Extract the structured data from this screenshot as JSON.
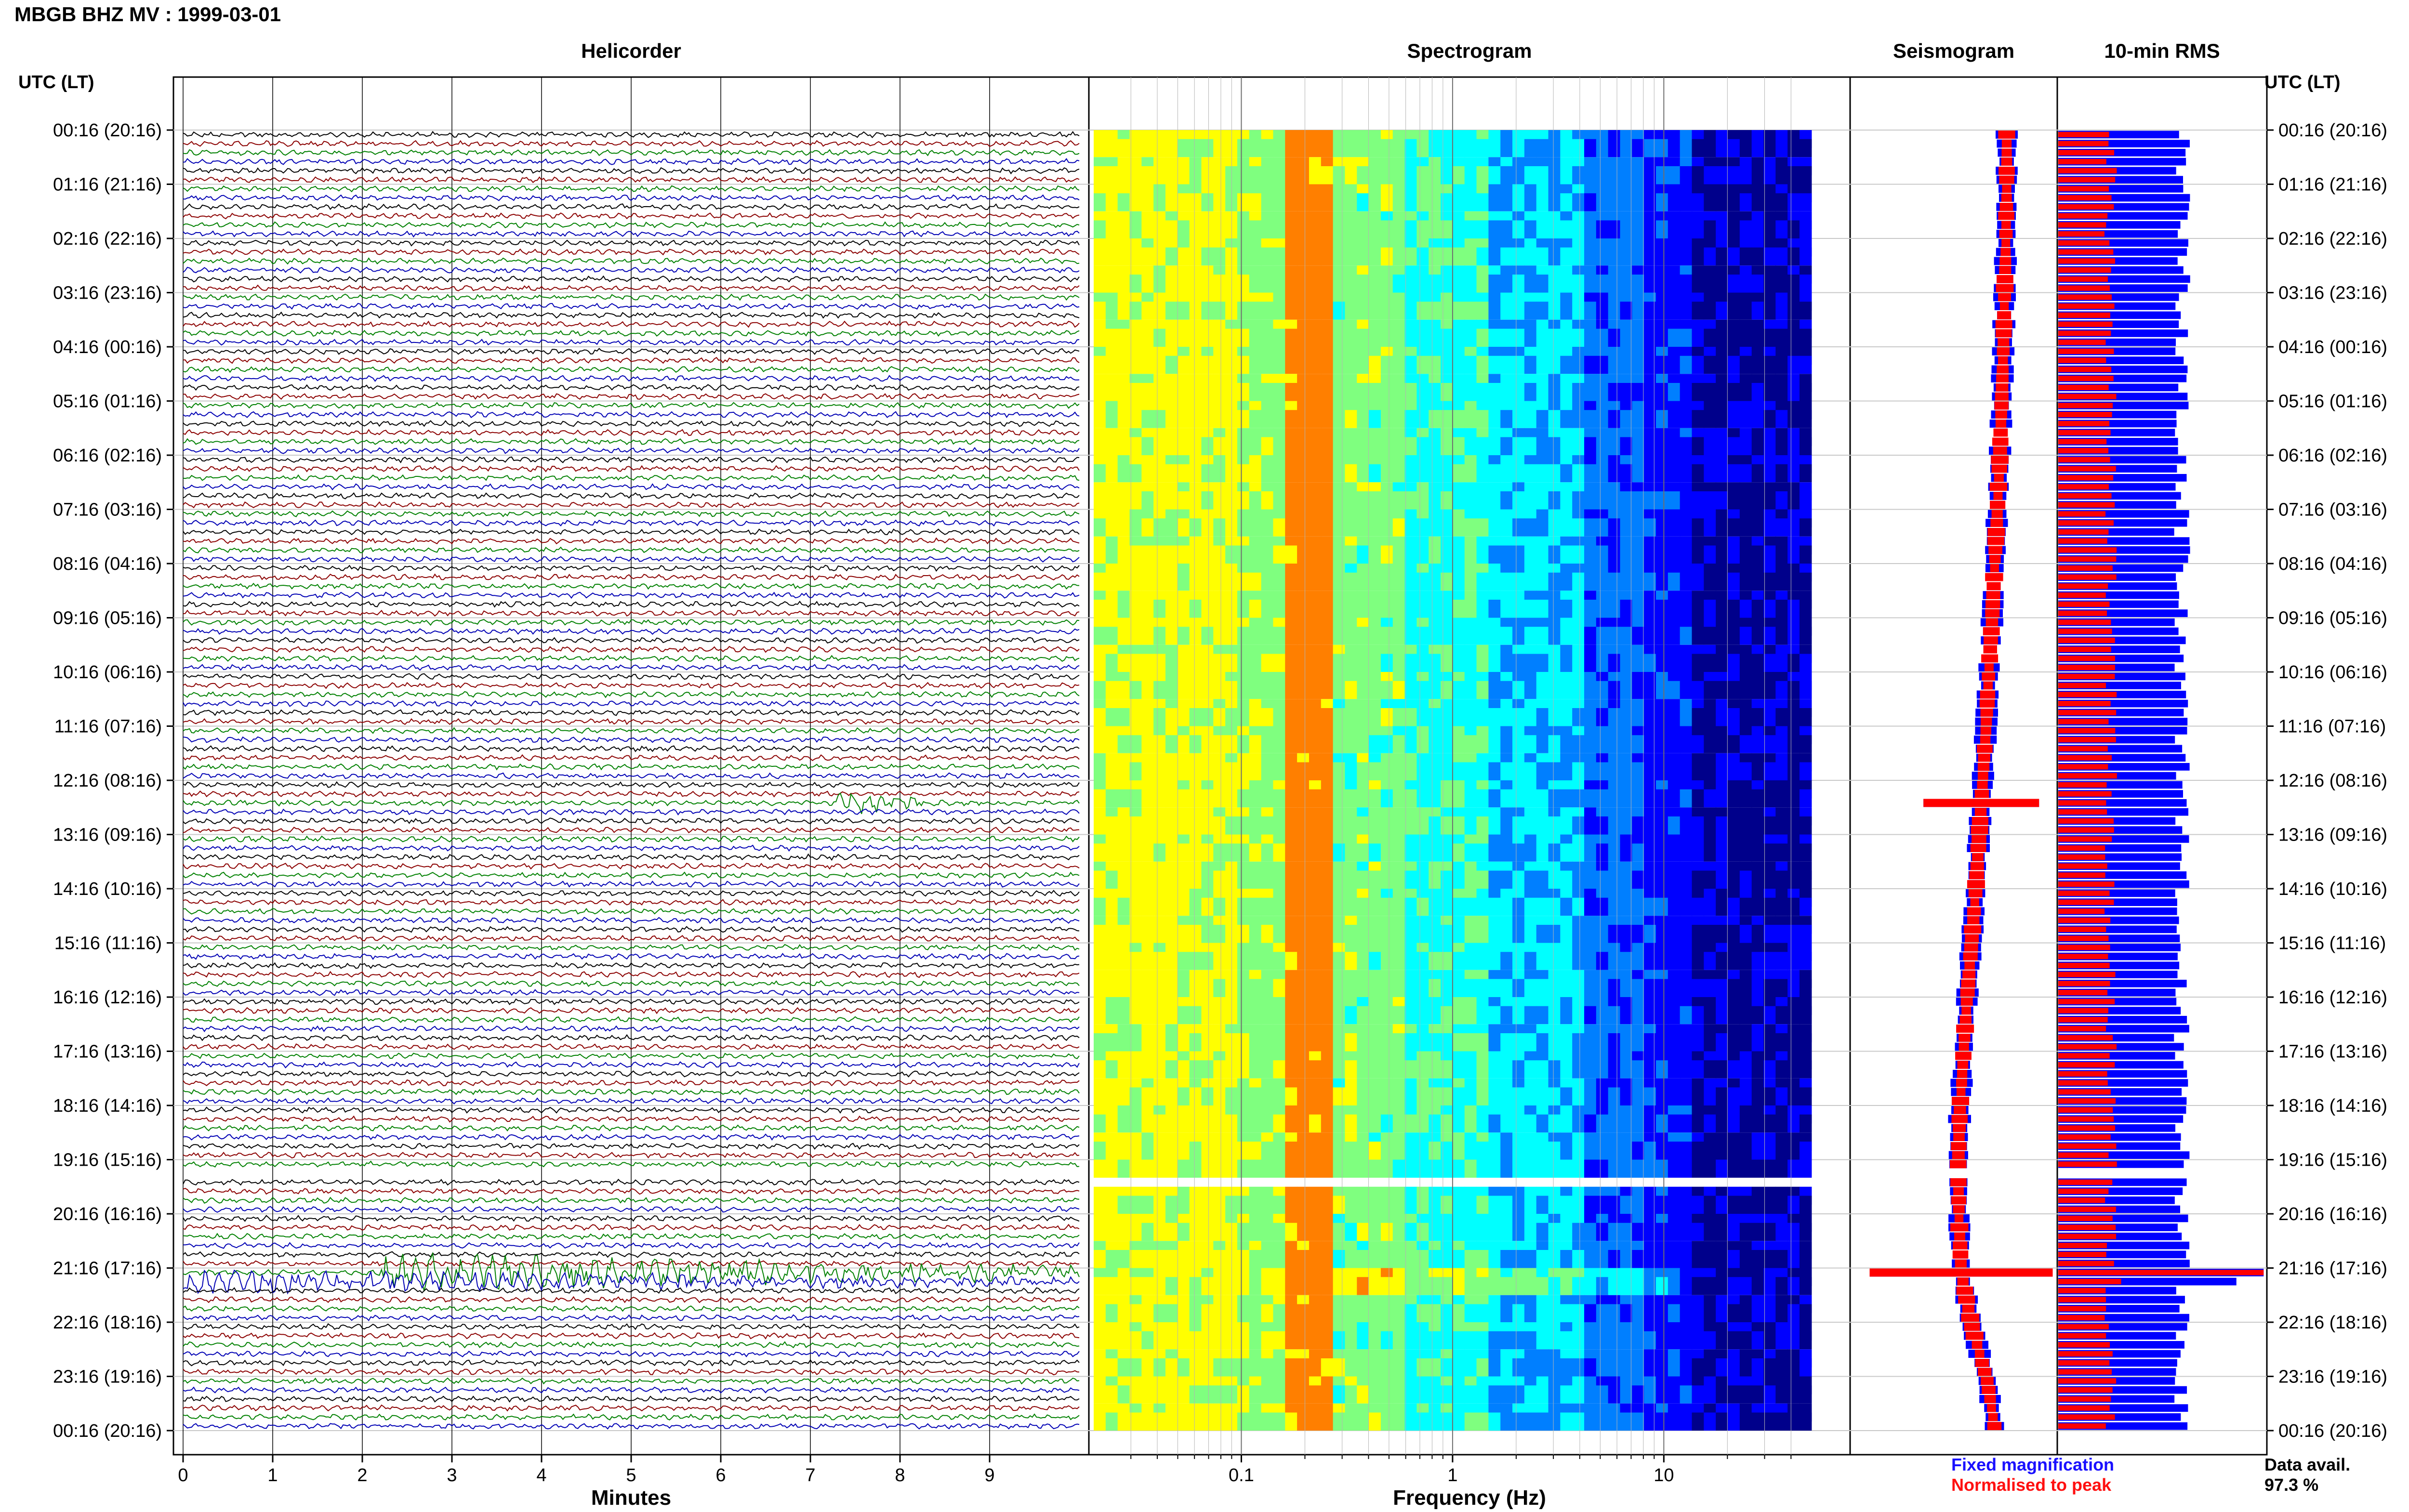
{
  "title": "MBGB BHZ MV : 1999-03-01",
  "utc_header": "UTC (LT)",
  "legend": {
    "fixed_magnification": "Fixed magnification",
    "normalised_to_peak": "Normalised to peak"
  },
  "data_availability": {
    "label": "Data avail.",
    "value": "97.3 %"
  },
  "colors": {
    "trace_cycle": [
      "#000000",
      "#8b0000",
      "#008000",
      "#0000b4"
    ],
    "fixed": "#0000ff",
    "normalised": "#ff0000"
  },
  "chart_data": [
    {
      "type": "line",
      "title": "Helicorder",
      "xlabel": "Minutes",
      "x_ticks": [
        0,
        1,
        2,
        3,
        4,
        5,
        6,
        7,
        8,
        9
      ],
      "xlim": [
        0,
        10
      ],
      "y_tick_labels": [
        "00:16 (20:16)",
        "01:16 (21:16)",
        "02:16 (22:16)",
        "03:16 (23:16)",
        "04:16 (00:16)",
        "05:16 (01:16)",
        "06:16 (02:16)",
        "07:16 (03:16)",
        "08:16 (04:16)",
        "09:16 (05:16)",
        "10:16 (06:16)",
        "11:16 (07:16)",
        "12:16 (08:16)",
        "13:16 (09:16)",
        "14:16 (10:16)",
        "15:16 (11:16)",
        "16:16 (12:16)",
        "17:16 (13:16)",
        "18:16 (14:16)",
        "19:16 (15:16)",
        "20:16 (16:16)",
        "21:16 (17:16)",
        "22:16 (18:16)",
        "23:16 (19:16)",
        "00:16 (20:16)"
      ],
      "rows": 144,
      "gap_row": 115,
      "events": [
        {
          "row": 74,
          "minute_start": 7.3,
          "minute_end": 8.2,
          "amplitude": 3.0
        },
        {
          "row": 126,
          "minute_start": 2.2,
          "minute_end": 10.0,
          "amplitude": 4.0
        },
        {
          "row": 127,
          "minute_start": 0.0,
          "minute_end": 10.0,
          "amplitude": 2.5
        }
      ]
    },
    {
      "type": "heatmap",
      "title": "Spectrogram",
      "xlabel": "Frequency (Hz)",
      "x_scale": "log",
      "xlim": [
        0.02,
        50
      ],
      "x_ticks": [
        0.1,
        1,
        10
      ],
      "x_tick_labels": [
        "0.1",
        "1",
        "10"
      ],
      "peak_band_hz": [
        0.17,
        0.28
      ],
      "colormap": [
        "#00008b",
        "#0000ff",
        "#007fff",
        "#00ffff",
        "#7fff7f",
        "#ffff00",
        "#ff7f00"
      ]
    },
    {
      "type": "line",
      "title": "Seismogram",
      "series": [
        {
          "name": "Fixed magnification",
          "color": "#0000ff"
        },
        {
          "name": "Normalised to peak",
          "color": "#ff0000"
        }
      ],
      "trend_hourly": [
        1.0,
        1.0,
        0.98,
        0.95,
        0.92,
        0.88,
        0.84,
        0.78,
        0.72,
        0.66,
        0.58,
        0.52,
        0.44,
        0.36,
        0.28,
        0.18,
        0.08,
        0.0,
        -0.08,
        -0.12,
        -0.1,
        -0.05,
        0.2,
        0.55,
        0.75
      ]
    },
    {
      "type": "bar",
      "title": "10-min RMS",
      "series": [
        {
          "name": "Fixed magnification",
          "color": "#0000ff",
          "level_fraction": 0.55
        },
        {
          "name": "Normalised to peak",
          "color": "#ff0000",
          "level_fraction": 0.22
        }
      ],
      "peak_row": 126
    }
  ]
}
